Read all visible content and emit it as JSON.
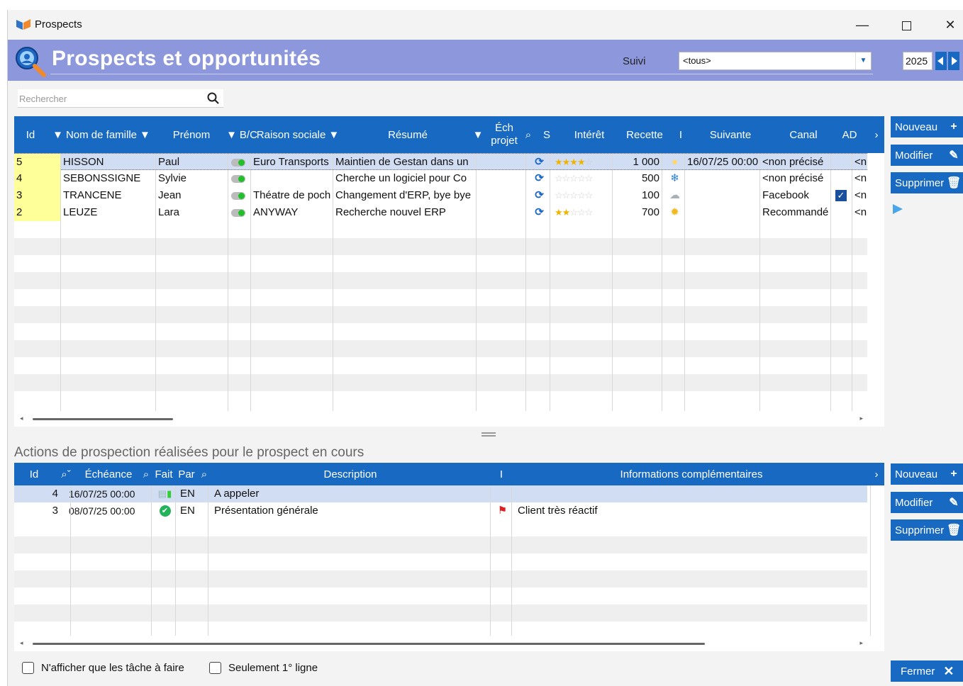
{
  "window": {
    "title": "Prospects"
  },
  "banner": {
    "heading": "Prospects et opportunités",
    "suivi_label": "Suivi",
    "suivi_value": "<tous>",
    "year": "2025"
  },
  "search": {
    "placeholder": "Rechercher"
  },
  "prospects": {
    "columns": [
      "Id",
      "Nom de famille",
      "Prénom",
      "B/C",
      "Raison sociale",
      "Résumé",
      "Éch projet",
      "S",
      "Intérêt",
      "Recette",
      "I",
      "Suivante",
      "Canal",
      "AD"
    ],
    "rows": [
      {
        "id": "5",
        "nom": "HISSON",
        "prenom": "Paul",
        "raison": "Euro Transports",
        "resume": "Maintien de Gestan dans un",
        "ech": "",
        "interet": 4,
        "recette": "1 000",
        "weather": "sun-faint-icon",
        "suivante": "16/07/25 00:00",
        "canal": "<non précisé",
        "ad": false,
        "next": "<n"
      },
      {
        "id": "4",
        "nom": "SEBONSSIGNE",
        "prenom": "Sylvie",
        "raison": "",
        "resume": "Cherche un logiciel pour Co",
        "ech": "",
        "interet": 0,
        "recette": "500",
        "weather": "snow-icon",
        "suivante": "",
        "canal": "<non précisé",
        "ad": false,
        "next": "<n"
      },
      {
        "id": "3",
        "nom": "TRANCENE",
        "prenom": "Jean",
        "raison": "Théatre de poch",
        "resume": "Changement d'ERP, bye bye",
        "ech": "",
        "interet": 0,
        "recette": "100",
        "weather": "cloud-icon",
        "suivante": "",
        "canal": "Facebook",
        "ad": true,
        "next": "<n"
      },
      {
        "id": "2",
        "nom": "LEUZE",
        "prenom": "Lara",
        "raison": "ANYWAY",
        "resume": "Recherche nouvel ERP",
        "ech": "",
        "interet": 2,
        "recette": "700",
        "weather": "sun-icon",
        "suivante": "",
        "canal": "Recommandé",
        "ad": false,
        "next": "<n"
      }
    ]
  },
  "side_top": {
    "new": "Nouveau",
    "edit": "Modifier",
    "delete": "Supprimer"
  },
  "actions": {
    "title": "Actions de prospection réalisées pour le prospect en cours",
    "columns": [
      "Id",
      "Échéance",
      "Fait",
      "Par",
      "Description",
      "I",
      "Informations complémentaires"
    ],
    "rows": [
      {
        "id": "4",
        "echeance": "16/07/25 00:00",
        "fait": "todo",
        "par": "EN",
        "description": "A appeler",
        "flag": false,
        "info": ""
      },
      {
        "id": "3",
        "echeance": "08/07/25 00:00",
        "fait": "done",
        "par": "EN",
        "description": "Présentation générale",
        "flag": true,
        "info": "Client très réactif"
      }
    ]
  },
  "side_bottom": {
    "new": "Nouveau",
    "edit": "Modifier",
    "delete": "Supprimer"
  },
  "footer": {
    "check1": "N'afficher que les tâche à faire",
    "check2": "Seulement 1° ligne",
    "close": "Fermer"
  },
  "colors": {
    "header_blue": "#1769c2",
    "banner": "#8d97dc",
    "id_yellow": "#ffff99",
    "selected": "#d1ddf3"
  }
}
